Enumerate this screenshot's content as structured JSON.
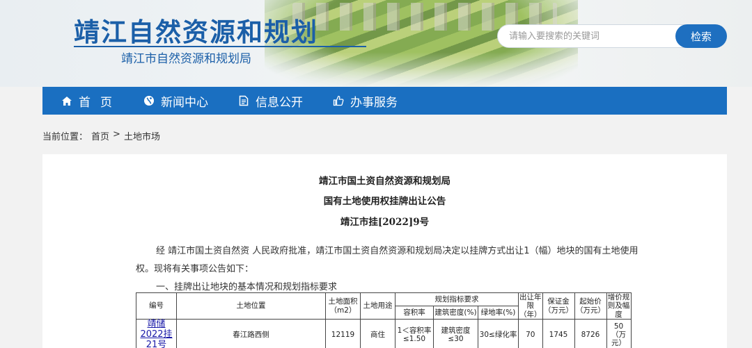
{
  "header": {
    "site_title": "靖江自然资源和规划",
    "site_subtitle": "靖江市自然资源和规划局",
    "search_placeholder": "请输入要搜索的关键词",
    "search_button": "检索"
  },
  "nav": {
    "items": [
      {
        "label": "首页",
        "icon": "home-icon"
      },
      {
        "label": "新闻中心",
        "icon": "globe-icon"
      },
      {
        "label": "信息公开",
        "icon": "document-icon"
      },
      {
        "label": "办事服务",
        "icon": "thumbs-up-icon"
      }
    ]
  },
  "breadcrumb": {
    "prefix": "当前位置：",
    "home": "首页",
    "separator": ">",
    "current": "土地市场"
  },
  "notice": {
    "issuer": "靖江市国土资自然资源和规划局",
    "title": "国有土地使用权挂牌出让公告",
    "number": "靖江市挂[2022]9号",
    "intro_line1": "经 靖江市国土资自然资 人民政府批准，靖江市国土资自然资源和规划局决定以挂牌方式出让1（幅）地块的国有土地使用",
    "intro_line2": "权。现将有关事项公告如下：",
    "section1": "一、挂牌出让地块的基本情况和规划指标要求"
  },
  "table": {
    "headers": {
      "code": "编号",
      "location": "土地位置",
      "area": "土地面积（m2）",
      "use": "土地用途",
      "planning": "规划指标要求",
      "far": "容积率",
      "density": "建筑密度(%)",
      "green": "绿地率(%)",
      "term": "出让年限（年）",
      "deposit": "保证金（万元）",
      "start_price": "起始价（万元）",
      "increment": "增价规则及幅度"
    },
    "rows": [
      {
        "code": "靖储2022挂21号",
        "location": "春江路西侧",
        "area": "12119",
        "use": "商住",
        "far": "1＜容积率≤1.50",
        "density": "建筑密度≤30",
        "green": "30≤绿化率",
        "term": "70",
        "deposit": "1745",
        "start_price": "8726",
        "increment": "50（万元）"
      }
    ]
  },
  "colors": {
    "brand_blue": "#1a6fc1",
    "title_blue": "#1b5fa8",
    "page_bg": "#f2f2f2"
  }
}
